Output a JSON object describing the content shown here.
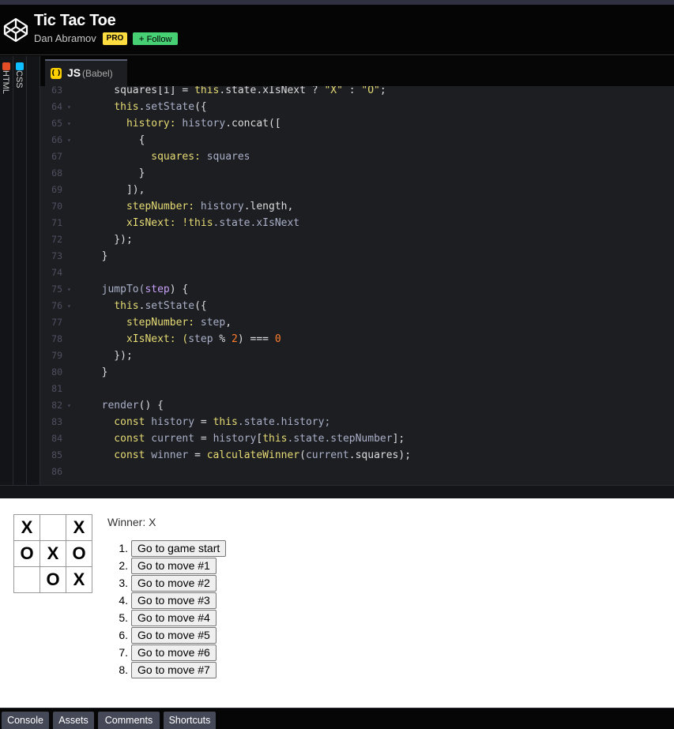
{
  "header": {
    "title": "Tic Tac Toe",
    "author": "Dan Abramov",
    "pro_badge": "PRO",
    "follow_label": "Follow",
    "follow_plus": "+"
  },
  "editor": {
    "side_tabs": [
      {
        "label": "HTML",
        "color": "#e44d26"
      },
      {
        "label": "CSS",
        "color": "#0ebeff"
      }
    ],
    "js_tab": {
      "label": "JS",
      "sub": "(Babel)",
      "icon_glyph": "( )"
    },
    "lines": [
      {
        "n": "63",
        "fold": "",
        "code": [
          [
            "    squares[i] = ",
            "#dcdcdc"
          ],
          [
            "this",
            "#e6db74"
          ],
          [
            ".state.xIsNext ? ",
            "#dcdcdc"
          ],
          [
            "\"X\"",
            "#e6db74"
          ],
          [
            " : ",
            "#dcdcdc"
          ],
          [
            "\"O\"",
            "#e6db74"
          ],
          [
            ";",
            "#dcdcdc"
          ]
        ]
      },
      {
        "n": "64",
        "fold": "▾",
        "code": [
          [
            "    ",
            "#dcdcdc"
          ],
          [
            "this",
            "#e6db74"
          ],
          [
            ".",
            "#dcdcdc"
          ],
          [
            "setState",
            "#a9b0c8"
          ],
          [
            "({",
            "#dcdcdc"
          ]
        ]
      },
      {
        "n": "65",
        "fold": "▾",
        "code": [
          [
            "      history: ",
            "#e6db74"
          ],
          [
            "history",
            "#a9b0c8"
          ],
          [
            ".concat([",
            "#dcdcdc"
          ]
        ]
      },
      {
        "n": "66",
        "fold": "▾",
        "code": [
          [
            "        {",
            "#dcdcdc"
          ]
        ]
      },
      {
        "n": "67",
        "fold": "",
        "code": [
          [
            "          squares: ",
            "#e6db74"
          ],
          [
            "squares",
            "#a9b0c8"
          ]
        ]
      },
      {
        "n": "68",
        "fold": "",
        "code": [
          [
            "        }",
            "#dcdcdc"
          ]
        ]
      },
      {
        "n": "69",
        "fold": "",
        "code": [
          [
            "      ]),",
            "#dcdcdc"
          ]
        ]
      },
      {
        "n": "70",
        "fold": "",
        "code": [
          [
            "      stepNumber: ",
            "#e6db74"
          ],
          [
            "history",
            "#a9b0c8"
          ],
          [
            ".length,",
            "#dcdcdc"
          ]
        ]
      },
      {
        "n": "71",
        "fold": "",
        "code": [
          [
            "      xIsNext: !",
            "#e6db74"
          ],
          [
            "this",
            "#e6db74"
          ],
          [
            ".state.xIsNext",
            "#a9b0c8"
          ]
        ]
      },
      {
        "n": "72",
        "fold": "",
        "code": [
          [
            "    });",
            "#dcdcdc"
          ]
        ]
      },
      {
        "n": "73",
        "fold": "",
        "code": [
          [
            "  }",
            "#dcdcdc"
          ]
        ]
      },
      {
        "n": "74",
        "fold": "",
        "code": [
          [
            "",
            "#dcdcdc"
          ]
        ]
      },
      {
        "n": "75",
        "fold": "▾",
        "code": [
          [
            "  jumpTo(",
            "#a9b0c8"
          ],
          [
            "step",
            "#c6a0f6"
          ],
          [
            ") {",
            "#dcdcdc"
          ]
        ]
      },
      {
        "n": "76",
        "fold": "▾",
        "code": [
          [
            "    ",
            "#dcdcdc"
          ],
          [
            "this",
            "#e6db74"
          ],
          [
            ".",
            "#dcdcdc"
          ],
          [
            "setState",
            "#a9b0c8"
          ],
          [
            "({",
            "#dcdcdc"
          ]
        ]
      },
      {
        "n": "77",
        "fold": "",
        "code": [
          [
            "      stepNumber: ",
            "#e6db74"
          ],
          [
            "step",
            "#a9b0c8"
          ],
          [
            ",",
            "#dcdcdc"
          ]
        ]
      },
      {
        "n": "78",
        "fold": "",
        "code": [
          [
            "      xIsNext: (",
            "#e6db74"
          ],
          [
            "step",
            "#a9b0c8"
          ],
          [
            " % ",
            "#dcdcdc"
          ],
          [
            "2",
            "#ff7e2e"
          ],
          [
            ") === ",
            "#dcdcdc"
          ],
          [
            "0",
            "#ff7e2e"
          ]
        ]
      },
      {
        "n": "79",
        "fold": "",
        "code": [
          [
            "    });",
            "#dcdcdc"
          ]
        ]
      },
      {
        "n": "80",
        "fold": "",
        "code": [
          [
            "  }",
            "#dcdcdc"
          ]
        ]
      },
      {
        "n": "81",
        "fold": "",
        "code": [
          [
            "",
            "#dcdcdc"
          ]
        ]
      },
      {
        "n": "82",
        "fold": "▾",
        "code": [
          [
            "  render",
            "#a9b0c8"
          ],
          [
            "() {",
            "#dcdcdc"
          ]
        ]
      },
      {
        "n": "83",
        "fold": "",
        "code": [
          [
            "    const ",
            "#e6db74"
          ],
          [
            "history",
            "#a9b0c8"
          ],
          [
            " = ",
            "#dcdcdc"
          ],
          [
            "this",
            "#e6db74"
          ],
          [
            ".state.history;",
            "#a9b0c8"
          ]
        ]
      },
      {
        "n": "84",
        "fold": "",
        "code": [
          [
            "    const ",
            "#e6db74"
          ],
          [
            "current",
            "#a9b0c8"
          ],
          [
            " = ",
            "#dcdcdc"
          ],
          [
            "history",
            "#a9b0c8"
          ],
          [
            "[",
            "#dcdcdc"
          ],
          [
            "this",
            "#e6db74"
          ],
          [
            ".state.stepNumber",
            "#a9b0c8"
          ],
          [
            "];",
            "#dcdcdc"
          ]
        ]
      },
      {
        "n": "85",
        "fold": "",
        "code": [
          [
            "    const ",
            "#e6db74"
          ],
          [
            "winner",
            "#a9b0c8"
          ],
          [
            " = ",
            "#dcdcdc"
          ],
          [
            "calculateWinner",
            "#e6db74"
          ],
          [
            "(",
            "#dcdcdc"
          ],
          [
            "current",
            "#a9b0c8"
          ],
          [
            ".squares);",
            "#dcdcdc"
          ]
        ]
      },
      {
        "n": "86",
        "fold": "",
        "code": [
          [
            "",
            "#dcdcdc"
          ]
        ]
      }
    ]
  },
  "game": {
    "board": [
      [
        "X",
        "",
        "X"
      ],
      [
        "O",
        "X",
        "O"
      ],
      [
        "",
        "O",
        "X"
      ]
    ],
    "status": "Winner: X",
    "moves": [
      {
        "num": "1.",
        "label": "Go to game start"
      },
      {
        "num": "2.",
        "label": "Go to move #1"
      },
      {
        "num": "3.",
        "label": "Go to move #2"
      },
      {
        "num": "4.",
        "label": "Go to move #3"
      },
      {
        "num": "5.",
        "label": "Go to move #4"
      },
      {
        "num": "6.",
        "label": "Go to move #5"
      },
      {
        "num": "7.",
        "label": "Go to move #6"
      },
      {
        "num": "8.",
        "label": "Go to move #7"
      }
    ]
  },
  "bottom_bar": {
    "buttons": [
      "Console",
      "Assets",
      "Comments",
      "Shortcuts"
    ]
  }
}
